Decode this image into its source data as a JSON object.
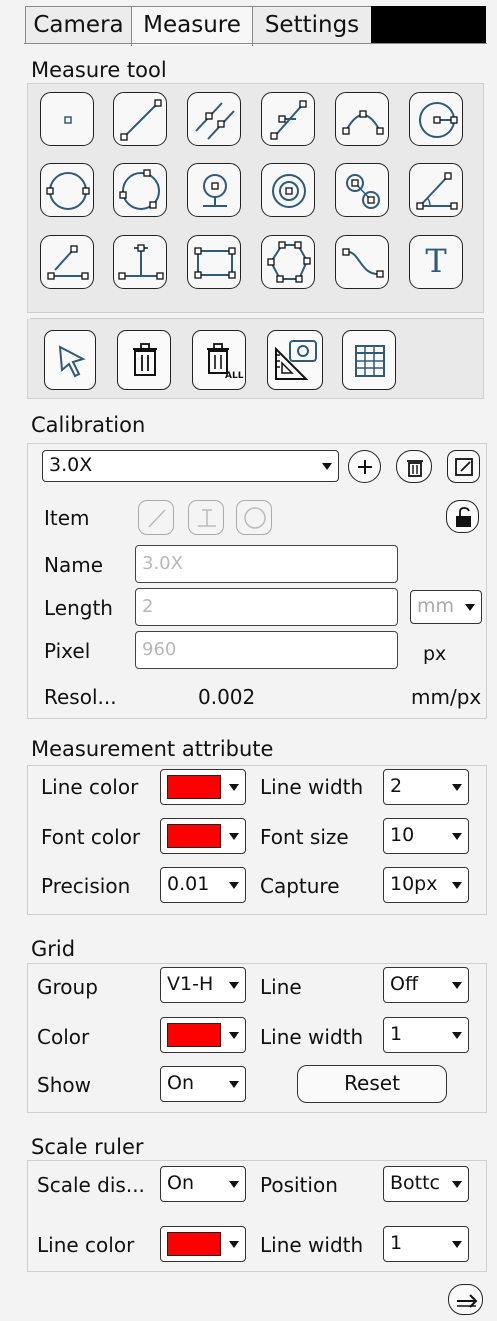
{
  "tabs": [
    {
      "label": "Camera"
    },
    {
      "label": "Measure"
    },
    {
      "label": "Settings"
    }
  ],
  "measure_tool": {
    "title": "Measure tool",
    "tools": [
      "point-icon",
      "line-icon",
      "parallel-lines-icon",
      "perpendicular-line-icon",
      "arc-three-point-icon",
      "circle-center-radius-icon",
      "circle-two-point-icon",
      "circle-three-point-icon",
      "circle-center-icon",
      "concentric-circles-icon",
      "two-circles-distance-icon",
      "angle-icon",
      "point-to-line-distance-icon",
      "line-height-icon",
      "rectangle-icon",
      "polygon-icon",
      "curve-icon",
      "text-icon"
    ],
    "actions": [
      "select-arrow-icon",
      "delete-icon",
      "delete-all-icon",
      "snapshot-measure-icon",
      "table-icon"
    ],
    "text_tool_glyph": "T"
  },
  "calibration": {
    "title": "Calibration",
    "selected": "3.0X",
    "item_label": "Item",
    "name_label": "Name",
    "name_placeholder": "3.0X",
    "length_label": "Length",
    "length_placeholder": "2",
    "length_unit": "mm",
    "pixel_label": "Pixel",
    "pixel_placeholder": "960",
    "pixel_unit": "px",
    "resolution_label": "Resol...",
    "resolution_value": "0.002",
    "resolution_unit": "mm/px"
  },
  "measurement_attribute": {
    "title": "Measurement attribute",
    "line_color_label": "Line color",
    "line_width_label": "Line width",
    "line_width_value": "2",
    "font_color_label": "Font color",
    "font_size_label": "Font size",
    "font_size_value": "10",
    "precision_label": "Precision",
    "precision_value": "0.01",
    "capture_label": "Capture",
    "capture_value": "10px"
  },
  "grid": {
    "title": "Grid",
    "group_label": "Group",
    "group_value": "V1-H",
    "line_label": "Line",
    "line_value": "Off",
    "color_label": "Color",
    "line_width_label": "Line width",
    "line_width_value": "1",
    "show_label": "Show",
    "show_value": "On",
    "reset_label": "Reset"
  },
  "scale_ruler": {
    "title": "Scale ruler",
    "scale_display_label": "Scale dis...",
    "scale_display_value": "On",
    "position_label": "Position",
    "position_value": "Bottc",
    "line_color_label": "Line color",
    "line_width_label": "Line width",
    "line_width_value": "1"
  },
  "colors": {
    "accent_red": "#ff0000",
    "icon_blue": "#2f5a78"
  }
}
